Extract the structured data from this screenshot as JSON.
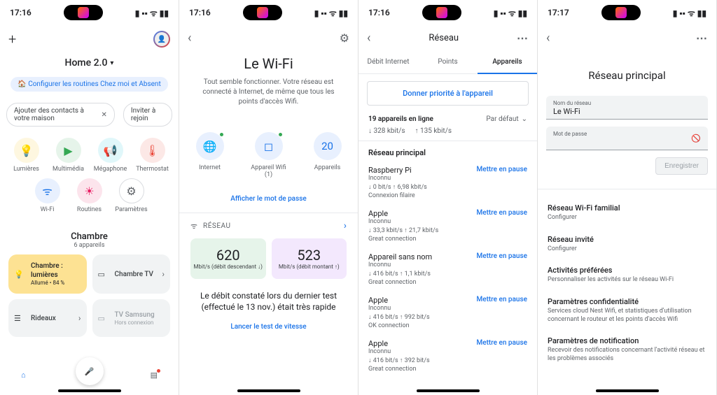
{
  "screens": {
    "s1": {
      "time": "17:16",
      "home_name": "Home 2.0",
      "routine_chip": "Configurer les routines Chez moi et Absent",
      "contacts_chip": "Ajouter des contacts à votre maison",
      "invite_chip": "Inviter à rejoin",
      "quick": {
        "lights": "Lumières",
        "media": "Multimédia",
        "mega": "Mégaphone",
        "thermo": "Thermostat",
        "wifi": "Wi-Fi",
        "routines": "Routines",
        "settings": "Paramètres"
      },
      "room": {
        "name": "Chambre",
        "sub": "6 appareils"
      },
      "cards": {
        "c1": {
          "title": "Chambre : lumières",
          "sub": "Allumé • 84 %"
        },
        "c2": {
          "title": "Chambre TV"
        },
        "c3": {
          "title": "Rideaux"
        },
        "c4": {
          "title": "TV Samsung",
          "sub": "Hors connexion"
        }
      }
    },
    "s2": {
      "time": "17:16",
      "title": "Le Wi-Fi",
      "desc": "Tout semble fonctionner. Votre réseau est connecté à Internet, de même que tous les points d'accès Wifi.",
      "circles": {
        "internet": "Internet",
        "wifi": "Appareil Wifi (1)",
        "devices": "Appareils",
        "devices_count": "20"
      },
      "show_pwd": "Afficher le mot de passe",
      "section_label": "RÉSEAU",
      "speed": {
        "down_num": "620",
        "down_lab": "Mbit/s (débit descendant ↓)",
        "up_num": "523",
        "up_lab": "Mbit/s (débit montant ↑)"
      },
      "result": "Le débit constaté lors du dernier test (effectué le 13 nov.) était très rapide",
      "run_test": "Lancer le test de vitesse"
    },
    "s3": {
      "time": "17:16",
      "title": "Réseau",
      "tabs": {
        "t1": "Débit Internet",
        "t2": "Points",
        "t3": "Appareils"
      },
      "priority": "Donner priorité à l'appareil",
      "online": "19 appareils en ligne",
      "sort": "Par défaut",
      "down": "↓   328 kbit/s",
      "up": "↑   135 kbit/s",
      "main_net": "Réseau principal",
      "pause": "Mettre en pause",
      "devices": [
        {
          "name": "Raspberry Pi",
          "unk": "Inconnu",
          "stats": "↓ 0 bit/s   ↑ 6,98 kbit/s",
          "qual": "Connexion filaire"
        },
        {
          "name": "Apple",
          "unk": "Inconnu",
          "stats": "↓ 33,3 kbit/s   ↑ 21,7 kbit/s",
          "qual": "Great connection"
        },
        {
          "name": "Appareil sans nom",
          "unk": "Inconnu",
          "stats": "↓ 416 bit/s   ↑ 1,1 kbit/s",
          "qual": "Great connection"
        },
        {
          "name": "Apple",
          "unk": "Inconnu",
          "stats": "↓ 416 bit/s   ↑ 992 bit/s",
          "qual": "OK connection"
        },
        {
          "name": "Apple",
          "unk": "Inconnu",
          "stats": "↓ 416 bit/s   ↑ 392 bit/s",
          "qual": "Great connection"
        }
      ]
    },
    "s4": {
      "time": "17:17",
      "title": "Réseau principal",
      "field1_label": "Nom du réseau",
      "field1_value": "Le Wi-Fi",
      "field2_label": "Mot de passe",
      "save": "Enregistrer",
      "settings": [
        {
          "h": "Réseau Wi-Fi familial",
          "d": "Configurer"
        },
        {
          "h": "Réseau invité",
          "d": "Configurer"
        },
        {
          "h": "Activités préférées",
          "d": "Personnaliser les activités sur le réseau Wi-Fi"
        },
        {
          "h": "Paramètres confidentialité",
          "d": "Services cloud Nest Wifi, et statistiques d'utilisation concernant le routeur et les points d'accès Wifi"
        },
        {
          "h": "Paramètres de notification",
          "d": "Recevoir des notifications concernant l'activité réseau et les problèmes associés"
        }
      ]
    }
  }
}
